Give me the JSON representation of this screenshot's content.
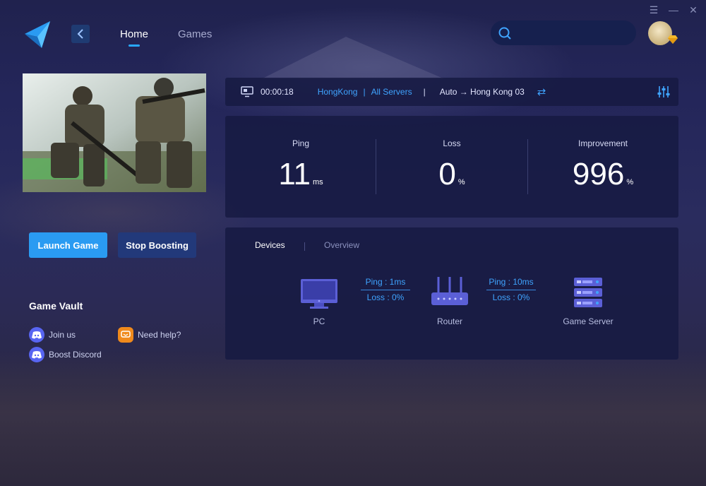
{
  "window": {
    "controls": [
      "☰",
      "—",
      "✕"
    ]
  },
  "header": {
    "back_icon": "chevron-left-icon",
    "tabs": [
      {
        "label": "Home",
        "active": true
      },
      {
        "label": "Games",
        "active": false
      }
    ],
    "search": {
      "placeholder": "",
      "value": ""
    }
  },
  "left": {
    "launch_label": "Launch Game",
    "stop_label": "Stop Boosting",
    "vault_title": "Game Vault",
    "links": {
      "join": "Join us",
      "help": "Need help?",
      "boost": "Boost Discord"
    }
  },
  "status": {
    "timer": "00:00:18",
    "region": "HongKong",
    "separator1": "|",
    "servers": "All Servers",
    "separator2": "|",
    "route": "Auto → Hong Kong 03",
    "swap_icon": "⇄"
  },
  "stats": [
    {
      "label": "Ping",
      "value": "11",
      "unit": "ms"
    },
    {
      "label": "Loss",
      "value": "0",
      "unit": "%"
    },
    {
      "label": "Improvement",
      "value": "996",
      "unit": "%"
    }
  ],
  "devices": {
    "tabs": [
      "Devices",
      "Overview"
    ],
    "nodes": {
      "pc": "PC",
      "router": "Router",
      "server": "Game Server"
    },
    "links": [
      {
        "ping": "Ping : 1ms",
        "loss": "Loss : 0%"
      },
      {
        "ping": "Ping : 10ms",
        "loss": "Loss : 0%"
      }
    ]
  },
  "colors": {
    "accent": "#2a9bf2",
    "link": "#3fa4ff",
    "panel": "#161a42",
    "background": "#22244f"
  }
}
